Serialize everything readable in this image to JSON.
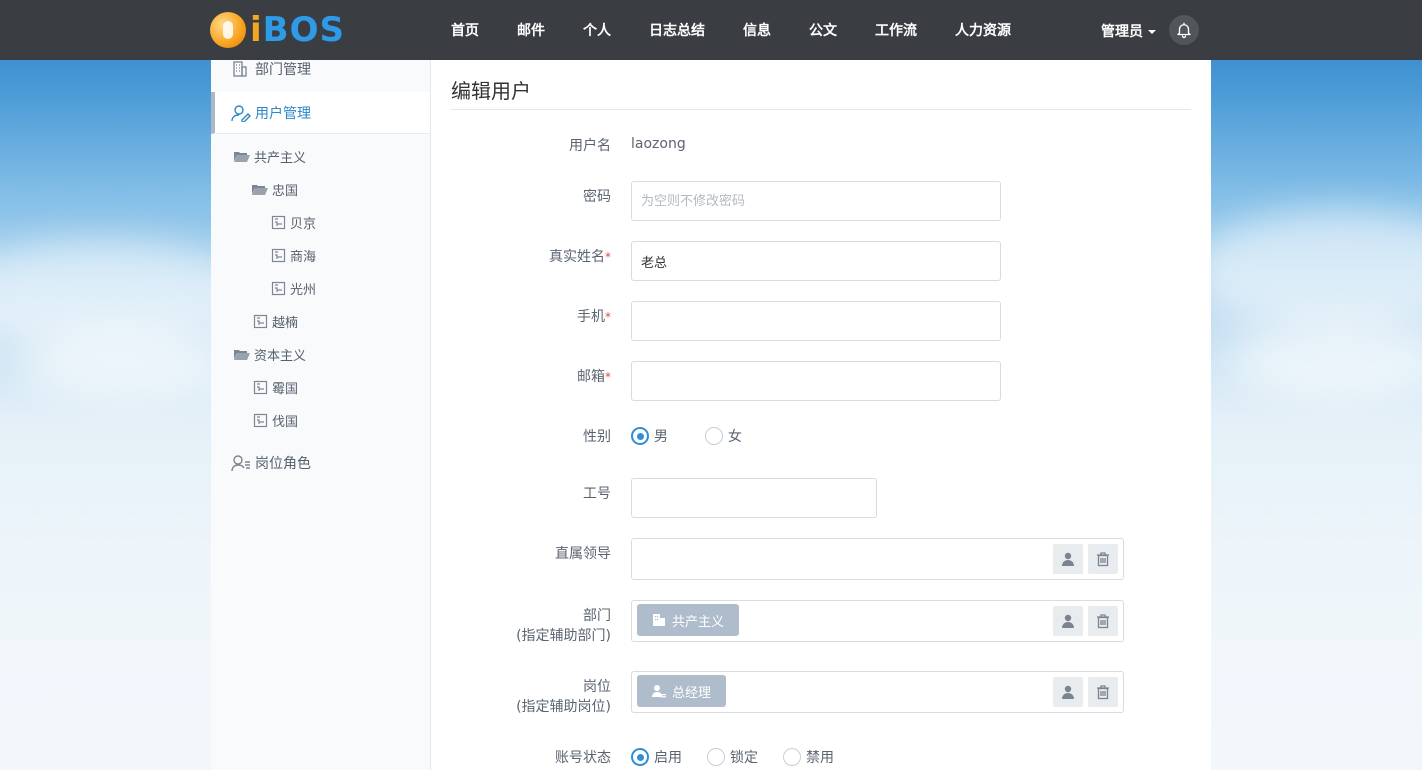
{
  "brand": {
    "logo_letter_i": "i",
    "logo_rest": "BOS"
  },
  "nav": {
    "items": [
      "首页",
      "邮件",
      "个人",
      "日志总结",
      "信息",
      "公文",
      "工作流",
      "人力资源"
    ],
    "user_label": "管理员"
  },
  "sidebar": {
    "links": [
      {
        "label": "部门管理",
        "icon": "building-icon"
      },
      {
        "label": "用户管理",
        "icon": "user-edit-icon",
        "active": true
      },
      {
        "label": "岗位角色",
        "icon": "user-list-icon"
      }
    ],
    "tree": [
      {
        "label": "共产主义",
        "icon": "folder-open-icon"
      },
      {
        "label": "忠国",
        "icon": "folder-open-icon"
      },
      {
        "label": "贝京",
        "icon": "org-doc-icon"
      },
      {
        "label": "商海",
        "icon": "org-doc-icon"
      },
      {
        "label": "光州",
        "icon": "org-doc-icon"
      },
      {
        "label": "越楠",
        "icon": "org-doc-icon"
      },
      {
        "label": "资本主义",
        "icon": "folder-open-icon"
      },
      {
        "label": "霉国",
        "icon": "org-doc-icon"
      },
      {
        "label": "伐国",
        "icon": "org-doc-icon"
      }
    ]
  },
  "form": {
    "title": "编辑用户",
    "username_label": "用户名",
    "username_value": "laozong",
    "password_label": "密码",
    "password_placeholder": "为空则不修改密码",
    "realname_label": "真实姓名",
    "realname_value": "老总",
    "mobile_label": "手机",
    "mobile_value": "",
    "email_label": "邮箱",
    "email_value": "",
    "required_mark": "*",
    "gender_label": "性别",
    "gender_options": [
      "男",
      "女"
    ],
    "gender_selected": "男",
    "jobnumber_label": "工号",
    "jobnumber_value": "",
    "supervisor_label": "直属领导",
    "department_label": "部门",
    "department_sub": "(指定辅助部门)",
    "department_chip": "共产主义",
    "position_label": "岗位",
    "position_sub": "(指定辅助岗位)",
    "position_chip": "总经理",
    "status_label": "账号状态",
    "status_options": [
      "启用",
      "锁定",
      "禁用"
    ],
    "status_selected": "启用"
  },
  "colors": {
    "accent": "#2f8fd6",
    "topbar": "#3a3d41",
    "chip": "#aebccb"
  }
}
